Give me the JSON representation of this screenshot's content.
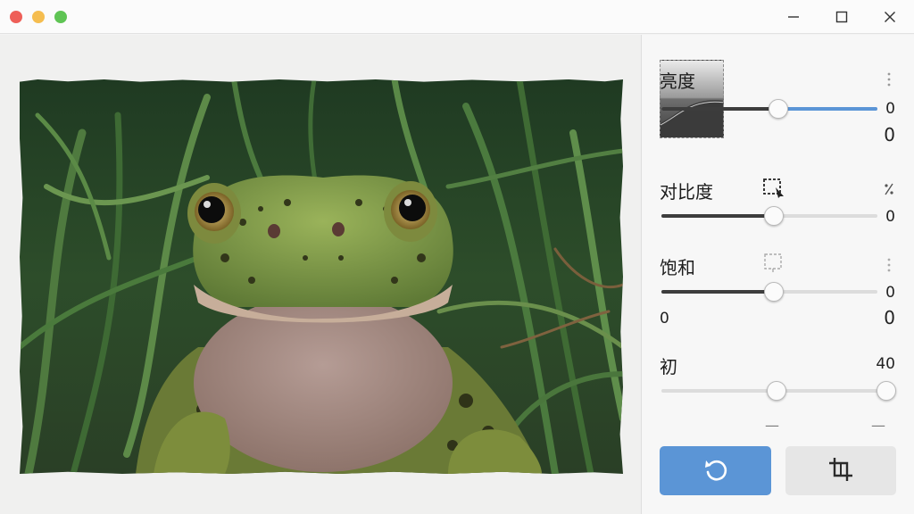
{
  "titlebar": {
    "icons": [
      "close-dot",
      "minimize-dot",
      "zoom-dot",
      "minimize-icon",
      "maximize-icon",
      "close-icon"
    ]
  },
  "adjustments": {
    "brightness": {
      "label": "亮度",
      "value": "0",
      "value_big": "0",
      "position": 0.54
    },
    "contrast": {
      "label": "对比度",
      "value": "0",
      "position": 0.52
    },
    "saturation": {
      "label": "饱和",
      "value": "0",
      "left_value": "0",
      "value_big": "0",
      "position": 0.52
    },
    "sharpness": {
      "label": "初",
      "value": "40",
      "position": 0.52,
      "max_position": 1.0
    }
  },
  "dashes": [
    "—",
    "—"
  ],
  "buttons": {
    "reset_icon": "rotate-ccw-icon",
    "crop_icon": "crop-icon"
  },
  "colors": {
    "accent": "#5b95d6",
    "track_fill": "#3d3d3d",
    "button_secondary": "#e6e6e6"
  }
}
